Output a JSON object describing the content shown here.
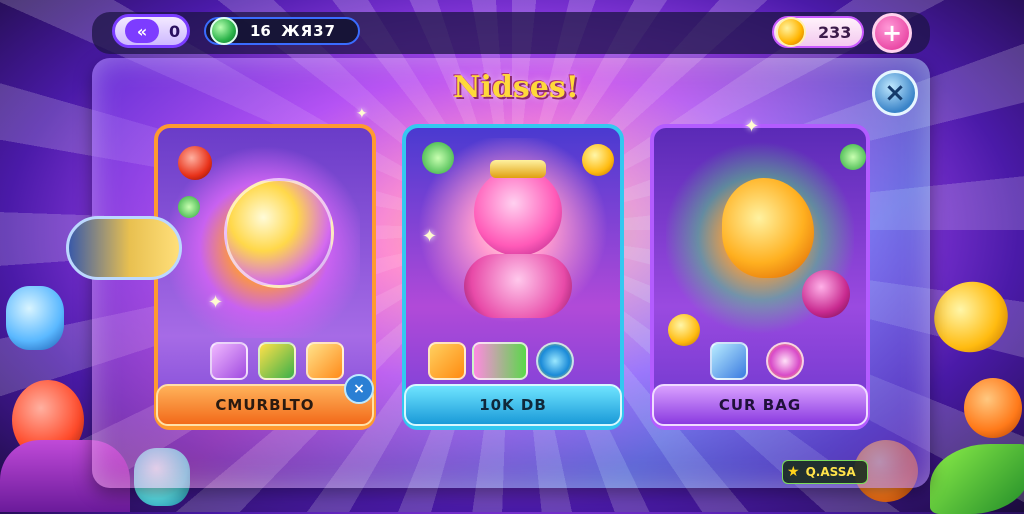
{
  "header": {
    "back_label": "0",
    "gem_count": "16",
    "gem_secondary": "ЖЯ37",
    "coin_count": "233",
    "plus_label": "+"
  },
  "title": "Nidses!",
  "close_label": "×",
  "cards": [
    {
      "label": "CMURBLTO",
      "item_icons": [
        "crystal-icon",
        "gift-box-icon",
        "ticket-icon"
      ]
    },
    {
      "label": "10K DB",
      "item_icons": [
        "heart-icon",
        "gem-cluster-icon",
        "moon-shield-icon"
      ]
    },
    {
      "label": "CUR BAG",
      "item_icons": [
        "diamond-icon",
        "moon-icon"
      ]
    }
  ],
  "shuffle_badge": "×",
  "promo_label": "Q.ASSA",
  "colors": {
    "card1_border": "#ff9a30",
    "card2_border": "#33c8f0",
    "card3_border": "#b35cff",
    "title": "#ffd93a"
  }
}
